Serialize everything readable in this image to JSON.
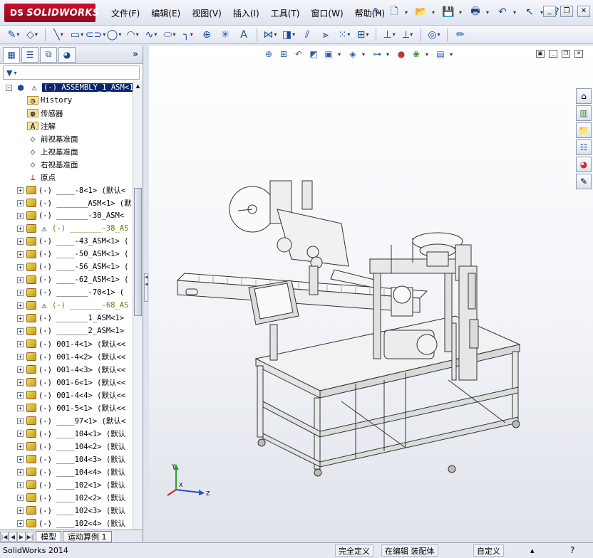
{
  "app": {
    "logo_text": "SOLIDWORKS",
    "logo_prefix": "DS"
  },
  "menu": [
    "文件(F)",
    "编辑(E)",
    "视图(V)",
    "插入(I)",
    "工具(T)",
    "窗口(W)",
    "帮助(H)"
  ],
  "feature_tree": {
    "root": "(-) ASSEMBLY_1_ASM<1",
    "fixed_items": [
      {
        "label": "History",
        "icon": "history-icon"
      },
      {
        "label": "传感器",
        "icon": "sensor-icon"
      },
      {
        "label": "注解",
        "icon": "annotation-icon"
      },
      {
        "label": "前视基准面",
        "icon": "plane-icon"
      },
      {
        "label": "上视基准面",
        "icon": "plane-icon"
      },
      {
        "label": "右视基准面",
        "icon": "plane-icon"
      },
      {
        "label": "原点",
        "icon": "origin-icon"
      }
    ],
    "components": [
      {
        "label": "(-) ____-8<1> (默认<",
        "warn": false
      },
      {
        "label": "(-) _______ASM<1> (默",
        "warn": false
      },
      {
        "label": "(-) _______-30_ASM<",
        "warn": false
      },
      {
        "label": "(-) _______-38_AS",
        "warn": true
      },
      {
        "label": "(-) ____-43_ASM<1> (",
        "warn": false
      },
      {
        "label": "(-) ____-50_ASM<1> (",
        "warn": false
      },
      {
        "label": "(-) ____-56_ASM<1> (",
        "warn": false
      },
      {
        "label": "(-) ____-62_ASM<1> (",
        "warn": false
      },
      {
        "label": "(-) _______-70<1> (",
        "warn": false
      },
      {
        "label": "(-) _______-68_AS",
        "warn": true
      },
      {
        "label": "(-) _______1_ASM<1>",
        "warn": false
      },
      {
        "label": "(-) _______2_ASM<1>",
        "warn": false
      },
      {
        "label": "(-) 001-4<1> (默认<<",
        "warn": false
      },
      {
        "label": "(-) 001-4<2> (默认<<",
        "warn": false
      },
      {
        "label": "(-) 001-4<3> (默认<<",
        "warn": false
      },
      {
        "label": "(-) 001-6<1> (默认<<",
        "warn": false
      },
      {
        "label": "(-) 001-4<4> (默认<<",
        "warn": false
      },
      {
        "label": "(-) 001-5<1> (默认<<",
        "warn": false
      },
      {
        "label": "(-) ____97<1> (默认<",
        "warn": false
      },
      {
        "label": "(-) ____104<1> (默认",
        "warn": false
      },
      {
        "label": "(-) ____104<2> (默认",
        "warn": false
      },
      {
        "label": "(-) ____104<3> (默认",
        "warn": false
      },
      {
        "label": "(-) ____104<4> (默认",
        "warn": false
      },
      {
        "label": "(-) ____102<1> (默认",
        "warn": false
      },
      {
        "label": "(-) ____102<2> (默认",
        "warn": false
      },
      {
        "label": "(-) ____102<3> (默认",
        "warn": false
      },
      {
        "label": "(-) ____102<4> (默认",
        "warn": false
      }
    ]
  },
  "bottom_tabs": {
    "model": "模型",
    "motion": "运动算例 1"
  },
  "status": {
    "app_name": "SolidWorks 2014",
    "definition": "完全定义",
    "editing": "在编辑 装配体",
    "custom": "自定义"
  },
  "triad": {
    "x": "X",
    "y": "Y",
    "z": "Z"
  }
}
